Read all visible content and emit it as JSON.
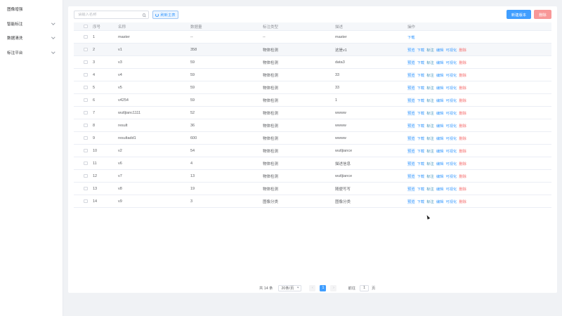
{
  "sidebar": {
    "items": [
      {
        "label": "图像增强",
        "expandable": false
      },
      {
        "label": "智能标注",
        "expandable": true
      },
      {
        "label": "数据清洗",
        "expandable": true
      },
      {
        "label": "标注平台",
        "expandable": true
      }
    ]
  },
  "toolbar": {
    "search_placeholder": "请输入名称",
    "search_value": "",
    "reset_label": "刷新主表",
    "new_version_label": "新建版本",
    "delete_label": "删除"
  },
  "table": {
    "headers": {
      "select": "",
      "no": "序号",
      "name": "名称",
      "count": "数据量",
      "type": "标注类型",
      "desc": "描述",
      "ops": "操作"
    },
    "rows": [
      {
        "no": "1",
        "name": "master",
        "count": "--",
        "type": "--",
        "desc": "master",
        "ops": [
          "下载"
        ]
      },
      {
        "no": "2",
        "name": "v1",
        "count": "358",
        "type": "物体检测",
        "desc": "这是v1",
        "ops": [
          "预览",
          "下载",
          "标注",
          "编辑",
          "可视化",
          "删除"
        ]
      },
      {
        "no": "3",
        "name": "v3",
        "count": "59",
        "type": "物体检测",
        "desc": "data3",
        "ops": [
          "预览",
          "下载",
          "标注",
          "编辑",
          "可视化",
          "删除"
        ]
      },
      {
        "no": "4",
        "name": "v4",
        "count": "59",
        "type": "物体检测",
        "desc": "33",
        "ops": [
          "预览",
          "下载",
          "标注",
          "编辑",
          "可视化",
          "删除"
        ]
      },
      {
        "no": "5",
        "name": "v5",
        "count": "59",
        "type": "物体检测",
        "desc": "33",
        "ops": [
          "预览",
          "下载",
          "标注",
          "编辑",
          "可视化",
          "删除"
        ]
      },
      {
        "no": "6",
        "name": "v4254",
        "count": "59",
        "type": "物体检测",
        "desc": "1",
        "ops": [
          "预览",
          "下载",
          "标注",
          "编辑",
          "可视化",
          "删除"
        ]
      },
      {
        "no": "7",
        "name": "wutljianc1111",
        "count": "52",
        "type": "物体检测",
        "desc": "wwww",
        "ops": [
          "预览",
          "下载",
          "标注",
          "编辑",
          "可视化",
          "删除"
        ]
      },
      {
        "no": "8",
        "name": "result",
        "count": "36",
        "type": "物体检测",
        "desc": "wwww",
        "ops": [
          "预览",
          "下载",
          "标注",
          "编辑",
          "可视化",
          "删除"
        ]
      },
      {
        "no": "9",
        "name": "resultadd1",
        "count": "600",
        "type": "物体检测",
        "desc": "wwww",
        "ops": [
          "预览",
          "下载",
          "标注",
          "编辑",
          "可视化",
          "删除"
        ]
      },
      {
        "no": "10",
        "name": "v2",
        "count": "54",
        "type": "物体检测",
        "desc": "wutljiance",
        "ops": [
          "预览",
          "下载",
          "标注",
          "编辑",
          "可视化",
          "删除"
        ]
      },
      {
        "no": "11",
        "name": "v6",
        "count": "4",
        "type": "物体检测",
        "desc": "描述信息",
        "ops": [
          "预览",
          "下载",
          "标注",
          "编辑",
          "可视化",
          "删除"
        ]
      },
      {
        "no": "12",
        "name": "v7",
        "count": "13",
        "type": "物体检测",
        "desc": "wutljiance",
        "ops": [
          "预览",
          "下载",
          "标注",
          "编辑",
          "可视化",
          "删除"
        ]
      },
      {
        "no": "13",
        "name": "v8",
        "count": "19",
        "type": "物体检测",
        "desc": "随便写写",
        "ops": [
          "预览",
          "下载",
          "标注",
          "编辑",
          "可视化",
          "删除"
        ]
      },
      {
        "no": "14",
        "name": "v9",
        "count": "3",
        "type": "图像分类",
        "desc": "图像分类",
        "ops": [
          "预览",
          "下载",
          "标注",
          "编辑",
          "可视化",
          "删除"
        ]
      }
    ]
  },
  "pagination": {
    "total_label": "共 14 条",
    "page_size_label": "20条/页",
    "prev_symbol": "‹",
    "next_symbol": "›",
    "current_page": "1",
    "goto_label": "前往",
    "goto_value": "1",
    "page_unit": "页"
  },
  "colors": {
    "primary": "#409eff",
    "danger_light": "#f89898",
    "danger_text": "#f56c6c"
  }
}
